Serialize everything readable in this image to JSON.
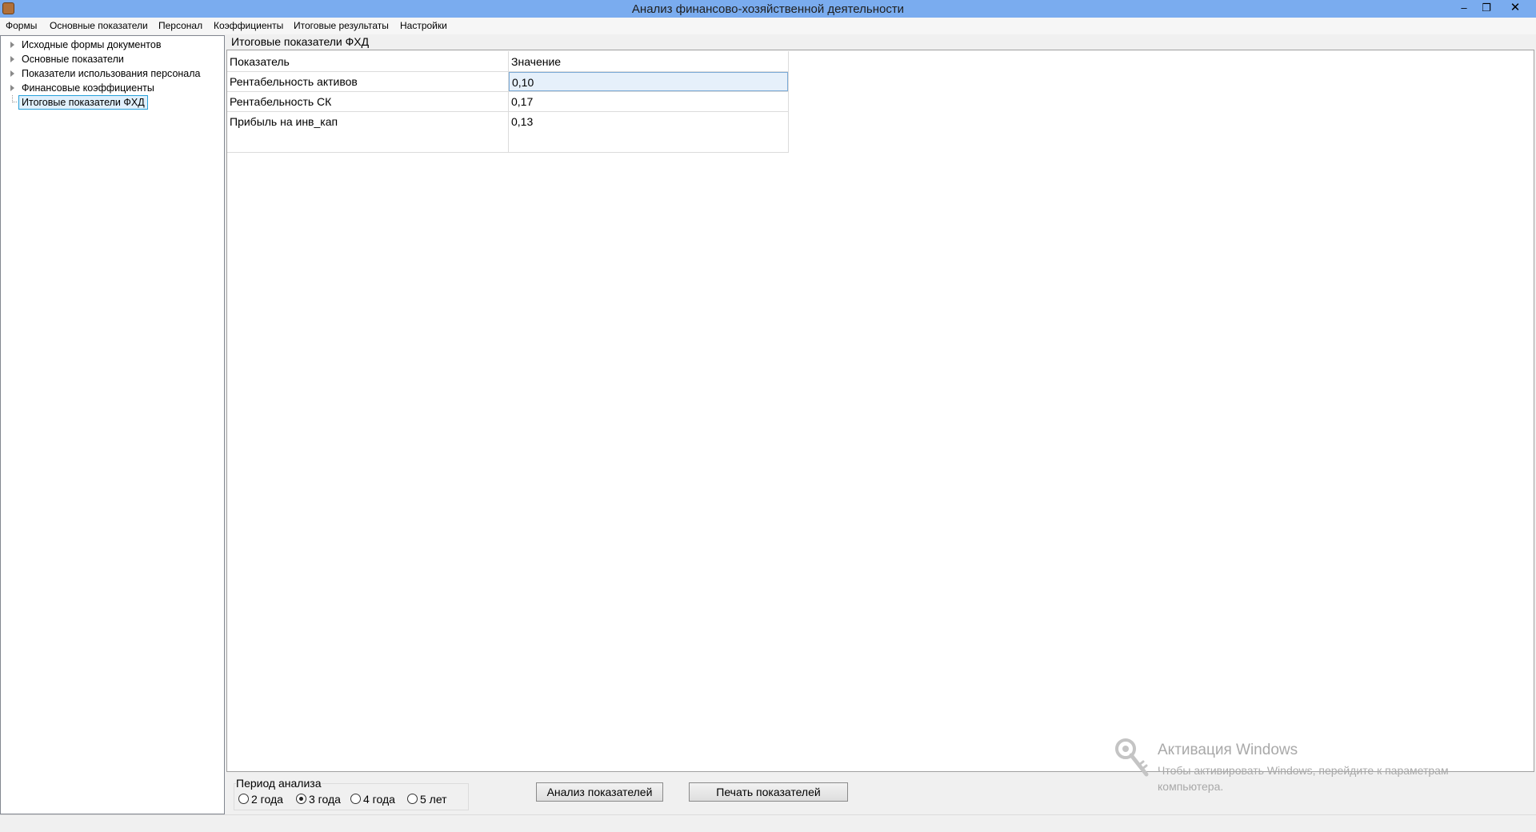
{
  "window": {
    "title": "Анализ финансово-хозяйственной деятельности",
    "minimize_glyph": "–",
    "restore_glyph": "❐",
    "close_glyph": "✕"
  },
  "menu": [
    "Формы",
    "Основные показатели",
    "Персонал",
    "Коэффициенты",
    "Итоговые результаты",
    "Настройки"
  ],
  "tree": {
    "items": [
      {
        "label": "Исходные формы документов",
        "expandable": true
      },
      {
        "label": "Основные показатели",
        "expandable": true
      },
      {
        "label": "Показатели  использования персонала",
        "expandable": true
      },
      {
        "label": "Финансовые коэффициенты",
        "expandable": true
      },
      {
        "label": "Итоговые показатели ФХД",
        "expandable": false,
        "selected": true
      }
    ]
  },
  "panel": {
    "title": "Итоговые показатели ФХД"
  },
  "grid": {
    "columns": [
      "Показатель",
      "Значение"
    ],
    "rows": [
      {
        "indicator": "Рентабельность активов",
        "value": "0,10"
      },
      {
        "indicator": "Рентабельность СК",
        "value": "0,17"
      },
      {
        "indicator": "Прибыль на инв_кап",
        "value": "0,13"
      }
    ]
  },
  "period": {
    "label": "Период анализа",
    "options": [
      "2 года",
      "3 года",
      "4 года",
      "5 лет"
    ],
    "selected": "3 года"
  },
  "buttons": {
    "analysis": "Анализ показателей",
    "print": "Печать показателей"
  },
  "watermark": {
    "title": "Активация Windows",
    "subtitle": "Чтобы активировать Windows, перейдите к параметрам компьютера."
  },
  "colors": {
    "titlebar": "#7aacef",
    "selection_border": "#26a0da",
    "selection_fill": "#e0f0fc"
  }
}
